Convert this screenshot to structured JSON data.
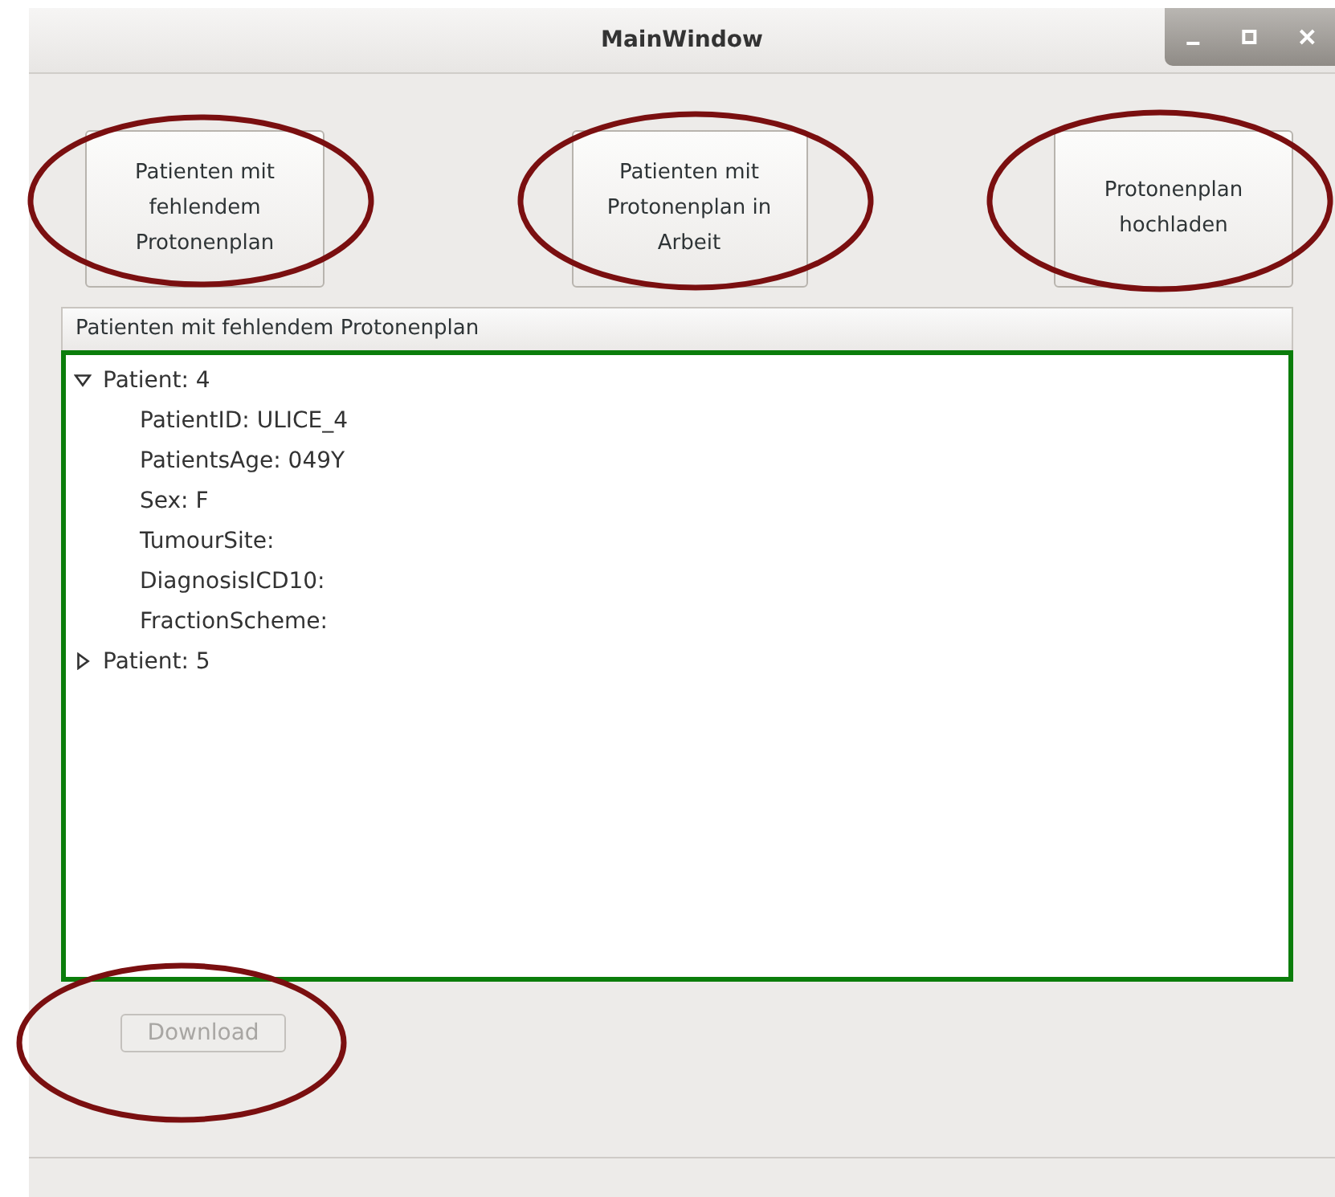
{
  "window": {
    "title": "MainWindow"
  },
  "buttons": [
    {
      "label": "Patienten mit fehlendem Protonenplan"
    },
    {
      "label": "Patienten mit Protonenplan in Arbeit"
    },
    {
      "label": "Protonenplan hochladen"
    }
  ],
  "tree": {
    "header": "Patienten mit fehlendem Protonenplan",
    "items": [
      {
        "label": "Patient: 4",
        "expanded": true,
        "children": [
          {
            "label": "PatientID: ULICE_4"
          },
          {
            "label": "PatientsAge: 049Y"
          },
          {
            "label": "Sex: F"
          },
          {
            "label": "TumourSite:"
          },
          {
            "label": "DiagnosisICD10:"
          },
          {
            "label": "FractionScheme:"
          }
        ]
      },
      {
        "label": "Patient: 5",
        "expanded": false
      }
    ]
  },
  "download_button": {
    "label": "Download",
    "disabled": true
  }
}
